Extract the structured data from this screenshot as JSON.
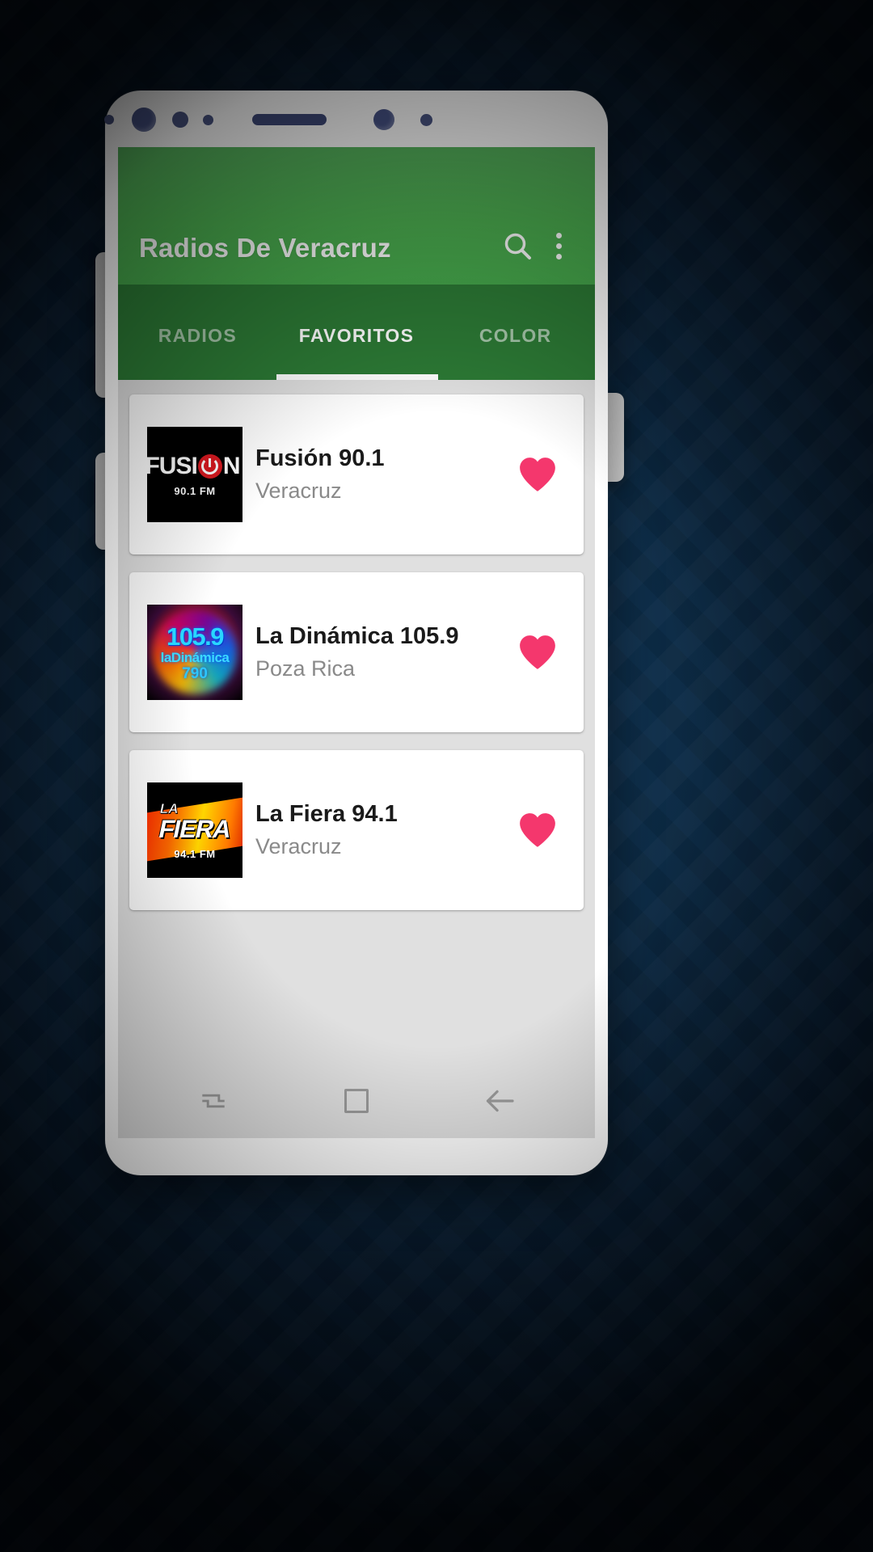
{
  "app": {
    "title": "Radios De Veracruz",
    "accent_green": "#4caf50",
    "tab_strip_green": "#2c7a35",
    "heart_color": "#f4376d",
    "card_background": "#ffffff",
    "content_background": "#e0e0e0"
  },
  "appbar": {
    "title": "Radios De Veracruz",
    "search_icon": "search-icon",
    "overflow_icon": "overflow-menu-icon"
  },
  "tabs": [
    {
      "label": "RADIOS",
      "active": false
    },
    {
      "label": "FAVORITOS",
      "active": true
    },
    {
      "label": "COLOR",
      "active": false
    }
  ],
  "stations": [
    {
      "name": "Fusión 90.1",
      "city": "Veracruz",
      "favorite": true,
      "logo": {
        "id": "fusion-logo",
        "line1_left": "FUSI",
        "line1_right": "N",
        "line2": "90.1 FM",
        "background": "#000000",
        "accent": "#d81920"
      }
    },
    {
      "name": "La Dinámica 105.9",
      "city": "Poza Rica",
      "favorite": true,
      "logo": {
        "id": "dinamica-logo",
        "line1": "105.9",
        "line2": "laDinámica",
        "line3": "790",
        "background": "#000000",
        "accent": "#29d6ff"
      }
    },
    {
      "name": "La Fiera 94.1",
      "city": "Veracruz",
      "favorite": true,
      "logo": {
        "id": "fiera-logo",
        "line1": "LA",
        "line2": "FIERA",
        "line3": "94.1 FM",
        "background": "#000000",
        "accent": "#ff6a00"
      }
    }
  ],
  "navbar": {
    "recents_label": "recents-icon",
    "home_label": "home-icon",
    "back_label": "back-icon"
  }
}
